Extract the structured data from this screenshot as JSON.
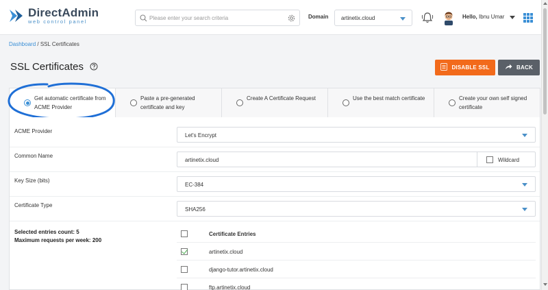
{
  "header": {
    "logo_title": "DirectAdmin",
    "logo_subtitle": "web control panel",
    "search_placeholder": "Please enter your search criteria",
    "domain_label": "Domain",
    "domain_value": "artinetix.cloud",
    "hello_prefix": "Hello,",
    "user_name": "Ibnu Umar"
  },
  "breadcrumb": {
    "home": "Dashboard",
    "separator": " / ",
    "current": "SSL Certificates"
  },
  "page": {
    "title": "SSL Certificates",
    "disable_ssl_label": "DISABLE SSL",
    "back_label": "BACK"
  },
  "tabs": [
    {
      "label": "Get automatic certificate from ACME Provider",
      "selected": true
    },
    {
      "label": "Paste a pre-generated certificate and key",
      "selected": false
    },
    {
      "label": "Create A Certificate Request",
      "selected": false
    },
    {
      "label": "Use the best match certificate",
      "selected": false
    },
    {
      "label": "Create your own self signed certificate",
      "selected": false
    }
  ],
  "form": {
    "acme_provider": {
      "label": "ACME Provider",
      "value": "Let's Encrypt"
    },
    "common_name": {
      "label": "Common Name",
      "value": "artinetix.cloud",
      "wildcard_label": "Wildcard"
    },
    "key_size": {
      "label": "Key Size (bits)",
      "value": "EC-384"
    },
    "cert_type": {
      "label": "Certificate Type",
      "value": "SHA256"
    },
    "selected_count": "Selected entries count: 5",
    "max_requests": "Maximum requests per week: 200",
    "entries_header": "Certificate Entries",
    "entries": [
      {
        "name": "artinetix.cloud",
        "checked": true
      },
      {
        "name": "django-tutor.artinetix.cloud",
        "checked": false
      },
      {
        "name": "ftp.artinetix.cloud",
        "checked": false
      }
    ]
  },
  "colors": {
    "accent": "#3a8fd6",
    "disable_btn": "#f26a1b",
    "back_btn": "#5a6068",
    "annotation": "#1f6fd6"
  },
  "icons": [
    "logo-mark-icon",
    "search-icon",
    "gear-icon",
    "bell-icon",
    "avatar-icon",
    "apps-grid-icon",
    "help-icon",
    "shield-icon",
    "share-arrow-icon"
  ]
}
